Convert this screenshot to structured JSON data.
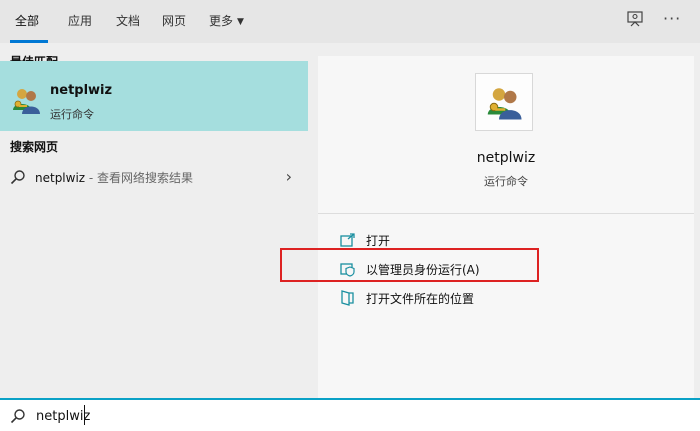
{
  "tabs": [
    {
      "label": "全部"
    },
    {
      "label": "应用"
    },
    {
      "label": "文档"
    },
    {
      "label": "网页"
    },
    {
      "label": "更多"
    }
  ],
  "left": {
    "best_match_header": "最佳匹配",
    "best_match": {
      "title": "netplwiz",
      "subtitle": "运行命令"
    },
    "web_header": "搜索网页",
    "web_result": {
      "query": "netplwiz",
      "suffix": " - 查看网络搜索结果"
    }
  },
  "right": {
    "title": "netplwiz",
    "subtitle": "运行命令",
    "actions": [
      {
        "label": "打开",
        "icon": "open-icon"
      },
      {
        "label": "以管理员身份运行(A)",
        "icon": "shield-icon"
      },
      {
        "label": "打开文件所在的位置",
        "icon": "folder-icon"
      }
    ]
  },
  "search": {
    "value": "netplwiz"
  },
  "colors": {
    "accent": "#0078d4",
    "selected_bg": "#a5dede",
    "highlight": "#dd2222",
    "icon_teal": "#1a8fa0"
  }
}
